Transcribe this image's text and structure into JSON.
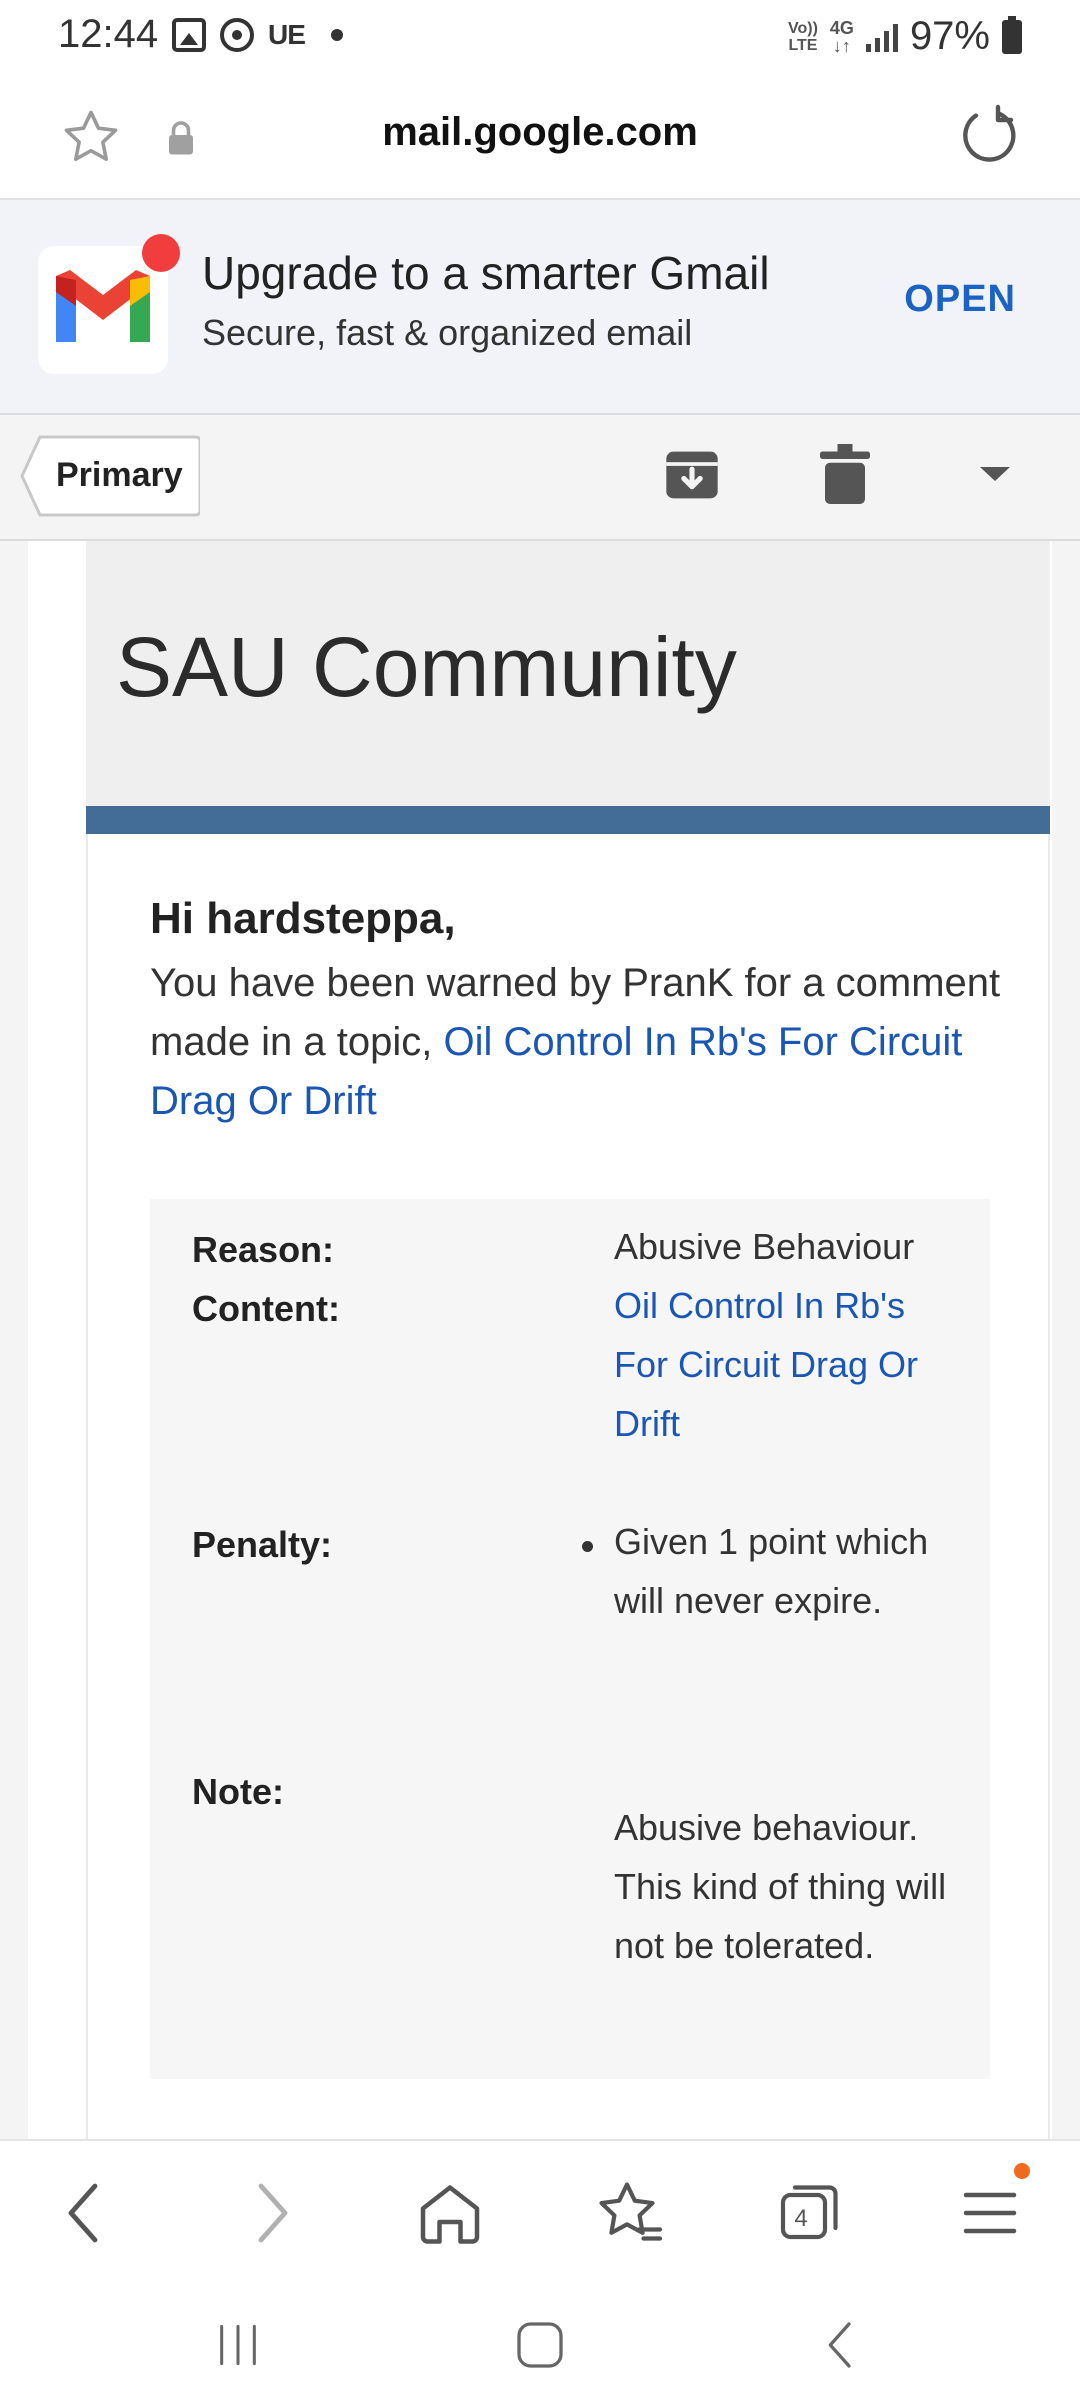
{
  "status_bar": {
    "time": "12:44",
    "carrier_tag": "UE",
    "volte_label": "Vo)) LTE",
    "network_label": "4G",
    "battery": "97%"
  },
  "browser": {
    "url": "mail.google.com"
  },
  "gmail_banner": {
    "title": "Upgrade to a smarter Gmail",
    "subtitle": "Secure, fast & organized email",
    "open_label": "OPEN"
  },
  "toolbar": {
    "primary_label": "Primary"
  },
  "email": {
    "header_title": "SAU Community",
    "accent_color": "#436c97",
    "greeting": "Hi hardsteppa,",
    "intro_text": "You have been warned by PranK for a comment made in a topic,",
    "intro_link": "Oil Control In Rb's For Circuit Drag Or Drift",
    "details": {
      "reason_label": "Reason:",
      "reason_value": "Abusive Behaviour",
      "content_label": "Content:",
      "content_value": "Oil Control In Rb's For Circuit Drag Or Drift",
      "penalty_label": "Penalty:",
      "penalty_value": "Given 1 point which will never expire.",
      "note_label": "Note:",
      "note_value": "Abusive behaviour. This kind of thing will not be tolerated."
    }
  },
  "browser_nav": {
    "tab_count": "4",
    "link_color": "#1a56b3"
  }
}
